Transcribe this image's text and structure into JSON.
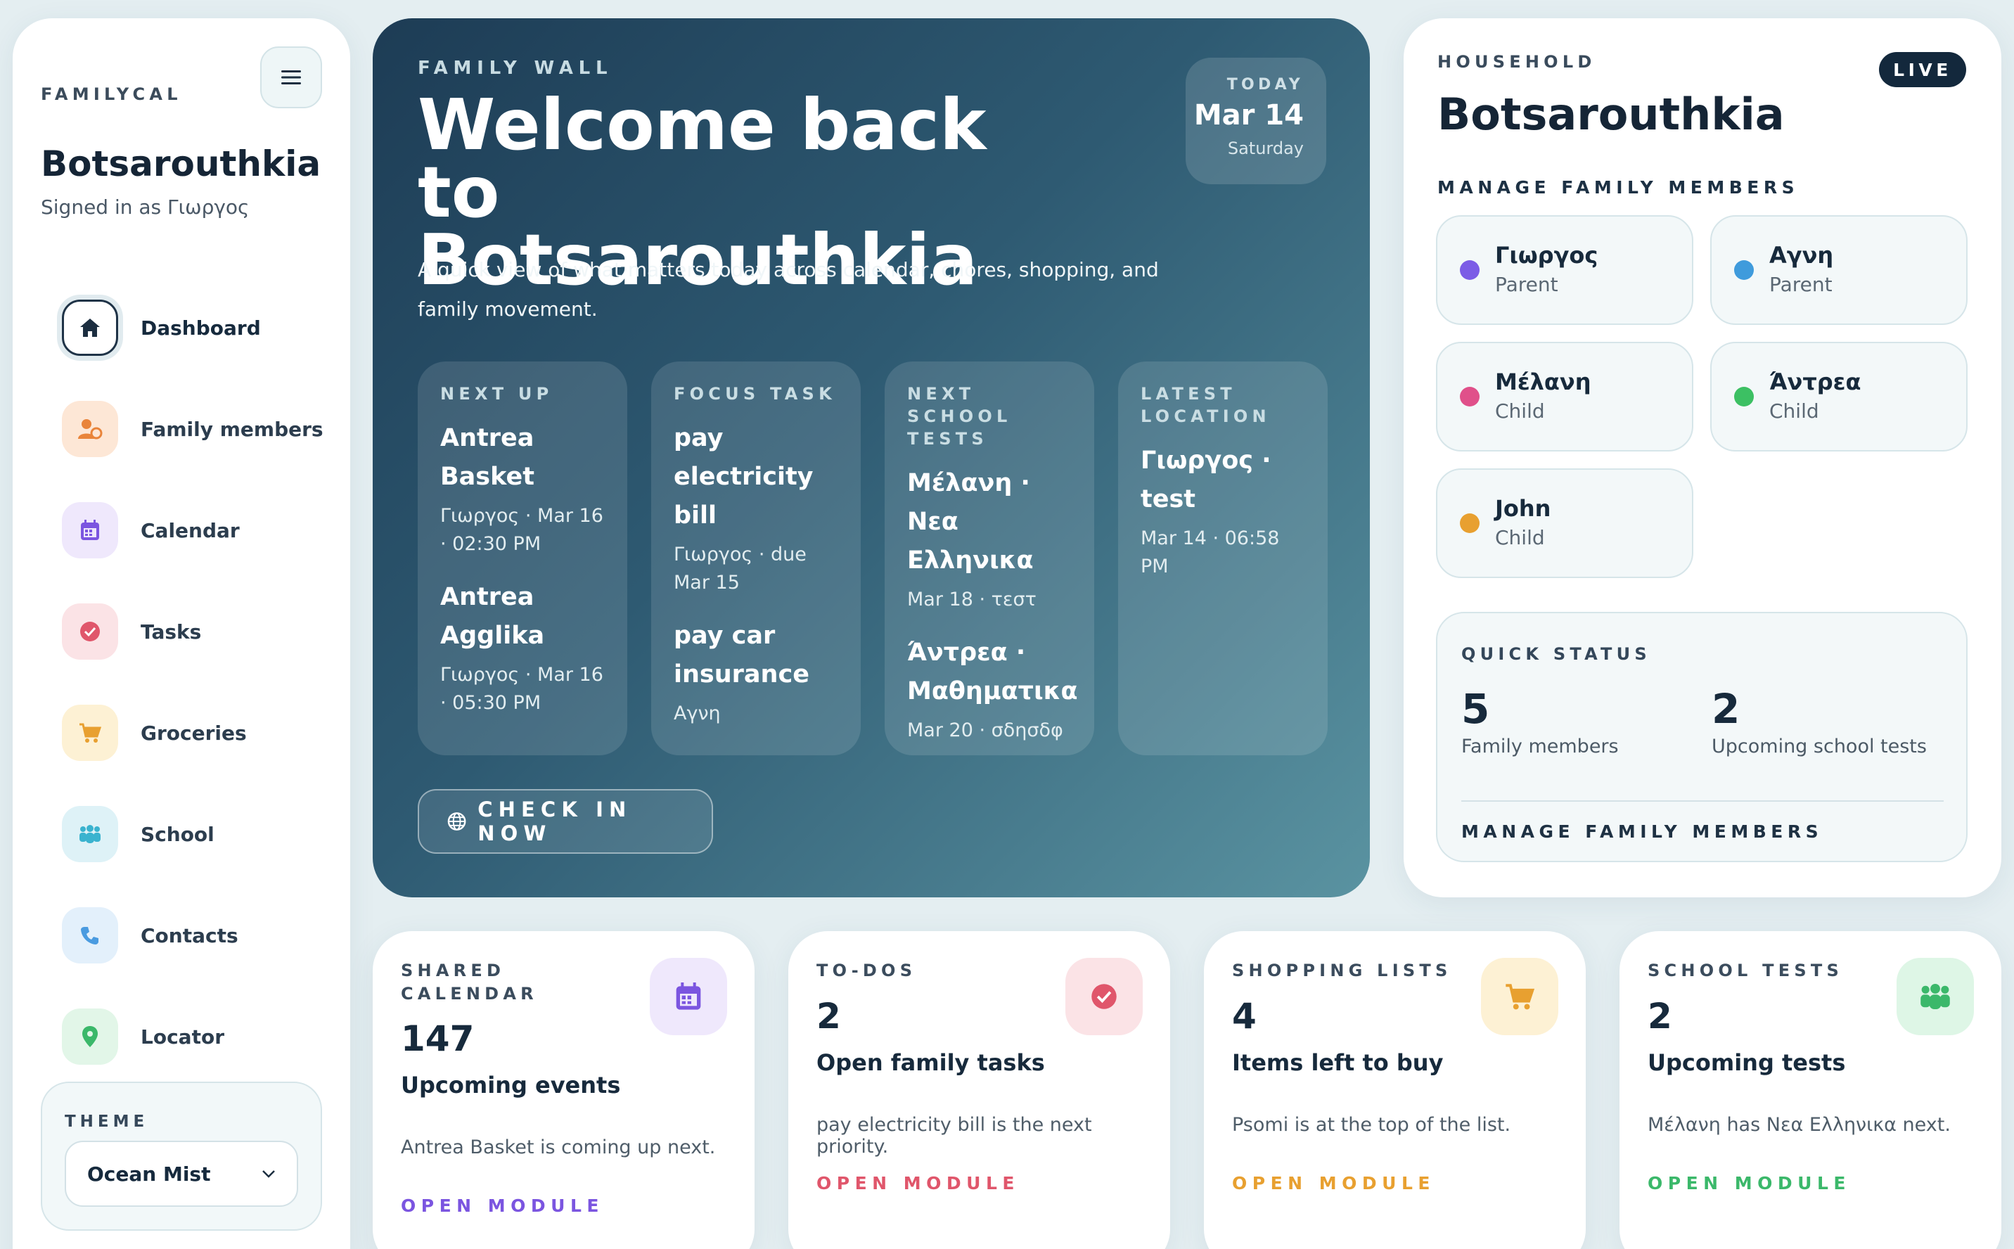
{
  "sidebar": {
    "brand": "FAMILYCAL",
    "menu_icon": "menu-icon",
    "title": "Botsarouthkia",
    "subtitle": "Signed in as Γιωργος",
    "nav": [
      {
        "label": "Dashboard",
        "icon": "home-icon"
      },
      {
        "label": "Family members",
        "icon": "family-members-icon"
      },
      {
        "label": "Calendar",
        "icon": "calendar-icon"
      },
      {
        "label": "Tasks",
        "icon": "check-circle-icon"
      },
      {
        "label": "Groceries",
        "icon": "cart-icon"
      },
      {
        "label": "School",
        "icon": "people-icon"
      },
      {
        "label": "Contacts",
        "icon": "phone-icon"
      },
      {
        "label": "Locator",
        "icon": "map-pin-icon"
      }
    ],
    "theme_label": "THEME",
    "theme_value": "Ocean Mist"
  },
  "hero": {
    "eyebrow": "FAMILY WALL",
    "title": "Welcome back to Botsarouthkia",
    "description": "A quick view of what matters today across calendar, chores, shopping, and family movement.",
    "today": {
      "label": "TODAY",
      "date": "Mar 14",
      "day": "Saturday"
    },
    "cards": [
      {
        "label": "NEXT UP",
        "items": [
          {
            "title": "Antrea Basket",
            "meta": "Γιωργος · Mar 16 · 02:30 PM"
          },
          {
            "title": "Antrea Agglika",
            "meta": "Γιωργος · Mar 16 · 05:30 PM"
          }
        ]
      },
      {
        "label": "FOCUS TASK",
        "items": [
          {
            "title": "pay electricity bill",
            "meta": "Γιωργος · due Mar 15"
          },
          {
            "title": "pay car insurance",
            "meta": "Αγνη"
          }
        ]
      },
      {
        "label": "NEXT SCHOOL TESTS",
        "items": [
          {
            "title": "Μέλανη · Νεα Ελληνικα",
            "meta": "Mar 18 · τεστ"
          },
          {
            "title": "Άντρεα · Μαθηματικα",
            "meta": "Mar 20 · σδησδφ"
          }
        ]
      },
      {
        "label": "LATEST LOCATION",
        "items": [
          {
            "title": "Γιωργος · test",
            "meta": "Mar 14 · 06:58 PM"
          }
        ]
      }
    ],
    "checkin_label": "CHECK IN NOW"
  },
  "household": {
    "eyebrow": "HOUSEHOLD",
    "live": "LIVE",
    "title": "Botsarouthkia",
    "manage_heading": "MANAGE FAMILY MEMBERS",
    "members": [
      {
        "name": "Γιωργος",
        "role": "Parent",
        "color": "#7c5ce6"
      },
      {
        "name": "Αγνη",
        "role": "Parent",
        "color": "#3f9bdc"
      },
      {
        "name": "Μέλανη",
        "role": "Child",
        "color": "#e0508a"
      },
      {
        "name": "Άντρεα",
        "role": "Child",
        "color": "#3cc063"
      },
      {
        "name": "John",
        "role": "Child",
        "color": "#e8a030"
      }
    ],
    "quick_status": {
      "label": "QUICK STATUS",
      "stats": [
        {
          "value": "5",
          "label": "Family members"
        },
        {
          "value": "2",
          "label": "Upcoming school tests"
        }
      ],
      "link": "MANAGE FAMILY MEMBERS"
    }
  },
  "modules": [
    {
      "label": "SHARED CALENDAR",
      "count": "147",
      "title": "Upcoming events",
      "desc": "Antrea Basket is coming up next.",
      "link": "OPEN MODULE",
      "accent": "#7b55e0",
      "icon_bg": "#efe8fc",
      "icon": "calendar-icon"
    },
    {
      "label": "TO-DOS",
      "count": "2",
      "title": "Open family tasks",
      "desc": "pay electricity bill is the next priority.",
      "link": "OPEN MODULE",
      "accent": "#e0566b",
      "icon_bg": "#fbe3e6",
      "icon": "check-circle-icon"
    },
    {
      "label": "SHOPPING LISTS",
      "count": "4",
      "title": "Items left to buy",
      "desc": "Psomi is at the top of the list.",
      "link": "OPEN MODULE",
      "accent": "#e8a030",
      "icon_bg": "#fdf1d4",
      "icon": "cart-icon"
    },
    {
      "label": "SCHOOL TESTS",
      "count": "2",
      "title": "Upcoming tests",
      "desc": "Μέλανη has Νεα Ελληνικα next.",
      "link": "OPEN MODULE",
      "accent": "#3bb86a",
      "icon_bg": "#def6e6",
      "icon": "people-icon"
    }
  ]
}
